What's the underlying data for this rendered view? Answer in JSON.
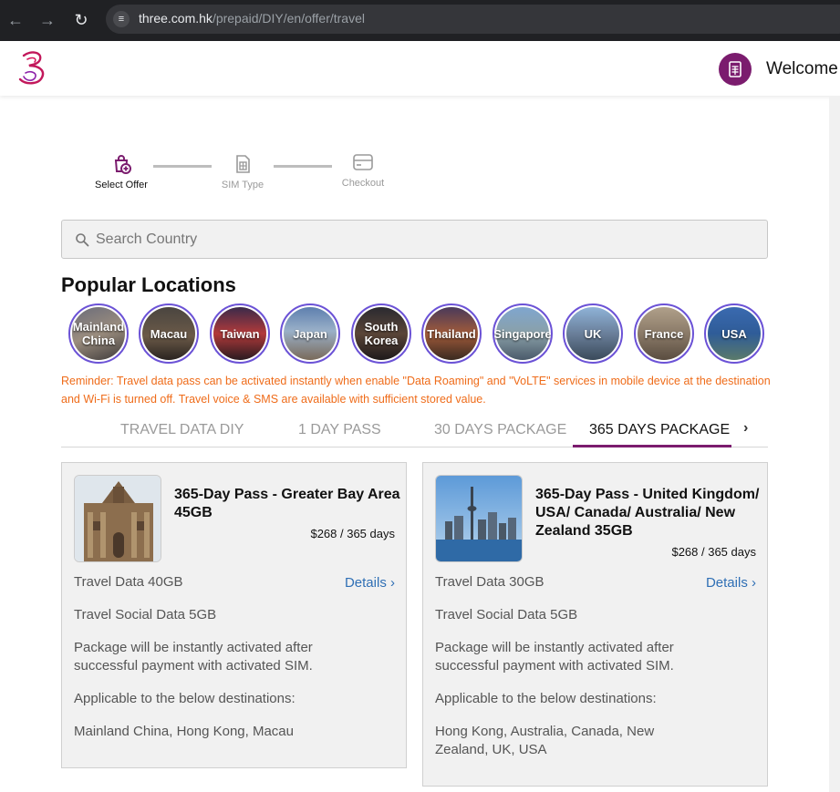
{
  "browser": {
    "url_host": "three.com.hk",
    "url_path": "/prepaid/DIY/en/offer/travel"
  },
  "header": {
    "welcome": "Welcome"
  },
  "stepper": {
    "steps": [
      "Select Offer",
      "SIM Type",
      "Checkout"
    ]
  },
  "search": {
    "placeholder": "Search Country"
  },
  "popular": {
    "title": "Popular Locations",
    "locations": [
      "Mainland China",
      "Macau",
      "Taiwan",
      "Japan",
      "South Korea",
      "Thailand",
      "Singapore",
      "UK",
      "France",
      "USA"
    ]
  },
  "reminder": "Reminder: Travel data pass can be activated instantly when enable \"Data Roaming\" and \"VoLTE\" services in mobile device at the destination and Wi-Fi is turned off. Travel voice & SMS are available with sufficient stored value.",
  "tabs": {
    "items": [
      "TRAVEL DATA DIY",
      "1 DAY PASS",
      "30 DAYS PACKAGE",
      "365 DAYS PACKAGE"
    ],
    "active": "365 DAYS PACKAGE",
    "next_icon": "chevron-right-icon"
  },
  "cards": [
    {
      "title": "365-Day Pass - Greater Bay Area 45GB",
      "price": "$268 / 365 days",
      "data_line": "Travel Data 40GB",
      "details": "Details",
      "social_line": "Travel Social Data 5GB",
      "activation": "Package will be instantly activated after successful payment with activated SIM.",
      "applicable_label": "Applicable to the below destinations:",
      "destinations": "Mainland China, Hong Kong, Macau"
    },
    {
      "title": "365-Day Pass - United Kingdom/ USA/ Canada/ Australia/ New Zealand 35GB",
      "price": "$268 / 365 days",
      "data_line": "Travel Data 30GB",
      "details": "Details",
      "social_line": "Travel Social Data 5GB",
      "activation": "Package will be instantly activated after successful payment with activated SIM.",
      "applicable_label": "Applicable to the below destinations:",
      "destinations": "Hong Kong, Australia, Canada, New Zealand, UK, USA"
    }
  ],
  "colors": {
    "brand": "#7b1c6e",
    "reminder": "#ef6c1a",
    "link": "#2f6fb5",
    "location_ring": "#6b52d6"
  }
}
